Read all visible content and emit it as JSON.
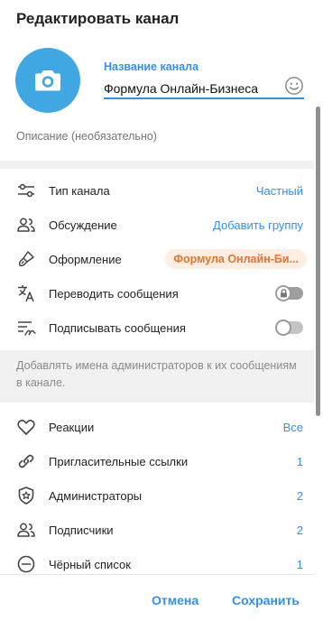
{
  "dialog": {
    "title": "Редактировать канал"
  },
  "channel": {
    "name_label": "Название канала",
    "name_value": "Формула Онлайн-Бизнеса",
    "description_placeholder": "Описание (необязательно)"
  },
  "settings": {
    "type": {
      "label": "Тип канала",
      "value": "Частный",
      "icon": "sliders-icon"
    },
    "discussion": {
      "label": "Обсуждение",
      "value": "Добавить группу",
      "icon": "people-icon"
    },
    "appearance": {
      "label": "Оформление",
      "value": "Формула Онлайн-Би...",
      "icon": "brush-icon"
    },
    "translate": {
      "label": "Переводить сообщения",
      "icon": "translate-icon",
      "toggle": "locked-off"
    },
    "sign": {
      "label": "Подписывать сообщения",
      "icon": "signature-icon",
      "toggle": "off"
    },
    "sign_hint": "Добавлять имена администраторов к их сообщениям в канале."
  },
  "management": {
    "reactions": {
      "label": "Реакции",
      "value": "Все",
      "icon": "heart-icon"
    },
    "invite_links": {
      "label": "Пригласительные ссылки",
      "value": "1",
      "icon": "link-icon"
    },
    "admins": {
      "label": "Администраторы",
      "value": "2",
      "icon": "shield-star-icon"
    },
    "subscribers": {
      "label": "Подписчики",
      "value": "2",
      "icon": "people-icon"
    },
    "blacklist": {
      "label": "Чёрный список",
      "value": "1",
      "icon": "minus-circle-icon"
    }
  },
  "footer": {
    "cancel_label": "Отмена",
    "save_label": "Сохранить"
  },
  "colors": {
    "accent": "#3390ec",
    "avatar": "#40a7e3",
    "appearance_pill_bg": "#fdeee3",
    "appearance_pill_text": "#e3752c"
  }
}
